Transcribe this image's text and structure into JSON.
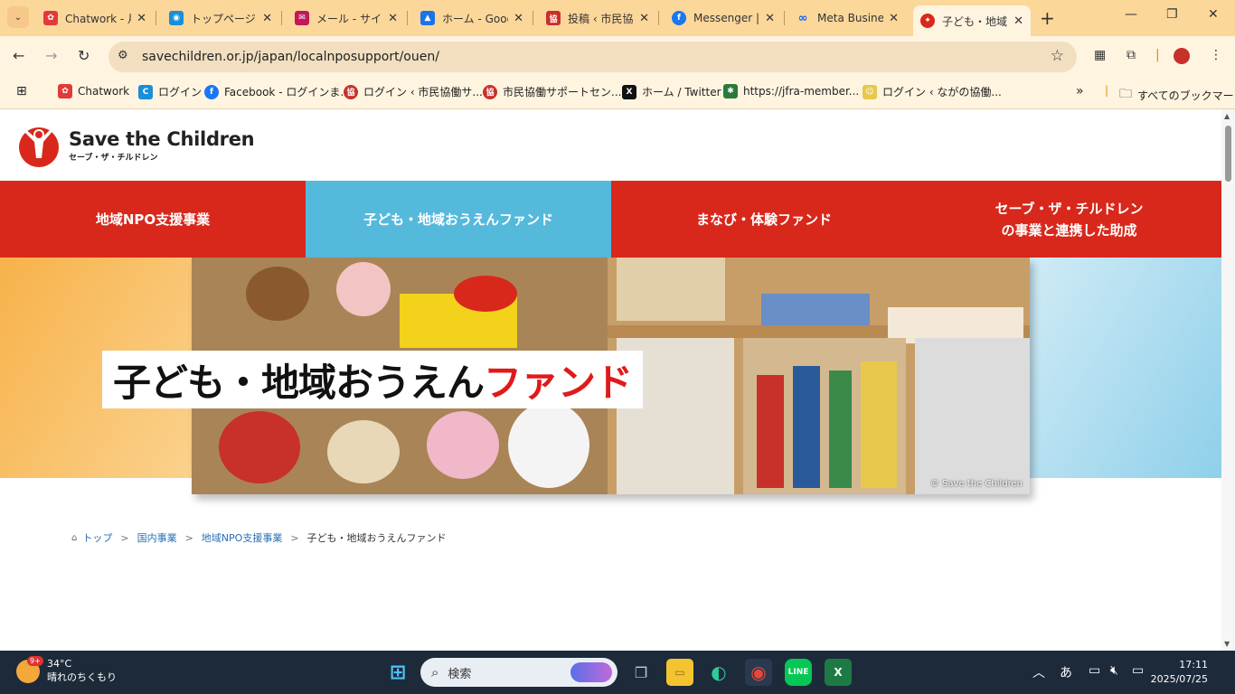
{
  "browser": {
    "tabs": [
      {
        "title": "Chatwork - 月",
        "color": "#e23a3a"
      },
      {
        "title": "トップページ - t",
        "color": "#1a8fd6"
      },
      {
        "title": "メール - サイボ",
        "color": "#c2185b"
      },
      {
        "title": "ホーム - Goog",
        "color": "#1a73e8"
      },
      {
        "title": "投稿 ‹ 市民協",
        "color": "#c8302a"
      },
      {
        "title": "Messenger |",
        "color": "#1877f2"
      },
      {
        "title": "Meta Busine",
        "color": "#0866ff"
      },
      {
        "title": "子ども・地域お",
        "color": "#d8281c"
      }
    ],
    "url": "savechildren.or.jp/japan/localnposupport/ouen/",
    "bookmarks": [
      "Chatwork",
      "ログイン",
      "Facebook - ログインま...",
      "ログイン ‹ 市民協働サ...",
      "市民協働サポートセン...",
      "ホーム / Twitter",
      "https://jfra-member...",
      "ログイン ‹ ながの協働..."
    ],
    "all_bookmarks": "すべてのブックマーク"
  },
  "site": {
    "logo_name": "Save the Children",
    "logo_sub": "セーブ・ザ・チルドレン",
    "nav": [
      "地域NPO支援事業",
      "子ども・地域おうえんファンド",
      "まなび・体験ファンド",
      "セーブ・ザ・チルドレン\nの事業と連携した助成"
    ],
    "hero_title_black": "子ども・地域おうえん",
    "hero_title_red": "ファンド",
    "copyright": "© Save the Children",
    "breadcrumb": [
      "トップ",
      "国内事業",
      "地域NPO支援事業",
      "子ども・地域おうえんファンド"
    ]
  },
  "taskbar": {
    "weather_temp": "34°C",
    "weather_desc": "晴れのちくもり",
    "weather_badge": "9+",
    "search_placeholder": "検索",
    "ime": "あ",
    "time": "17:11",
    "date": "2025/07/25"
  }
}
